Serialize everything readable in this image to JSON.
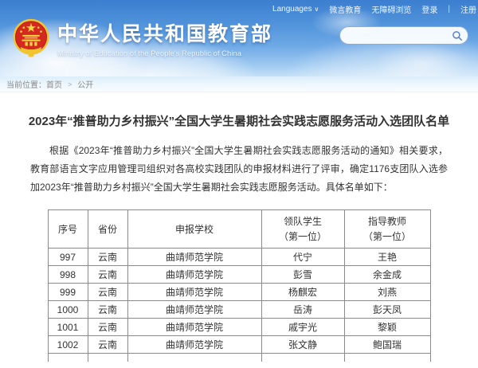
{
  "topbar": {
    "languages_label": "Languages",
    "caret": "∨",
    "link_weiyan": "微言教育",
    "link_accessibility": "无障碍浏览",
    "link_login": "登录",
    "separator": "|",
    "link_register": "注册"
  },
  "header": {
    "site_title": "中华人民共和国教育部",
    "site_subtitle": "Ministry of Education of the People's Republic of China",
    "search_placeholder": ""
  },
  "breadcrumb": {
    "prefix": "当前位置：",
    "home": "首页",
    "separator": ">",
    "section": "公开"
  },
  "article": {
    "title": "2023年“推普助力乡村振兴”全国大学生暑期社会实践志愿服务活动入选团队名单",
    "paragraph": "根据《2023年“推普助力乡村振兴”全国大学生暑期社会实践志愿服务活动的通知》相关要求，教育部语言文字应用管理司组织对各高校实践团队的申报材料进行了评审，确定1176支团队入选参加2023年“推普助力乡村振兴”全国大学生暑期社会实践志愿服务活动。具体名单如下："
  },
  "table": {
    "headers": [
      {
        "lines": [
          "序号"
        ]
      },
      {
        "lines": [
          "省份"
        ]
      },
      {
        "lines": [
          "申报学校"
        ]
      },
      {
        "lines": [
          "领队学生",
          "（第一位）"
        ]
      },
      {
        "lines": [
          "指导教师",
          "（第一位）"
        ]
      }
    ],
    "rows": [
      [
        "997",
        "云南",
        "曲靖师范学院",
        "代宁",
        "王艳"
      ],
      [
        "998",
        "云南",
        "曲靖师范学院",
        "彭雪",
        "余金成"
      ],
      [
        "999",
        "云南",
        "曲靖师范学院",
        "杨麒宏",
        "刘燕"
      ],
      [
        "1000",
        "云南",
        "曲靖师范学院",
        "岳涛",
        "彭天凤"
      ],
      [
        "1001",
        "云南",
        "曲靖师范学院",
        "戚宇光",
        "黎颖"
      ],
      [
        "1002",
        "云南",
        "曲靖师范学院",
        "张文静",
        "鲍国瑞"
      ]
    ]
  },
  "colors": {
    "sky_top": "#3c7ecf",
    "sky_bottom": "#c4e0f7",
    "emblem_red": "#d5281e",
    "emblem_gold": "#f2c431",
    "table_border": "#8a8a8a",
    "text": "#333333",
    "breadcrumb_text": "#8a8a8a"
  }
}
